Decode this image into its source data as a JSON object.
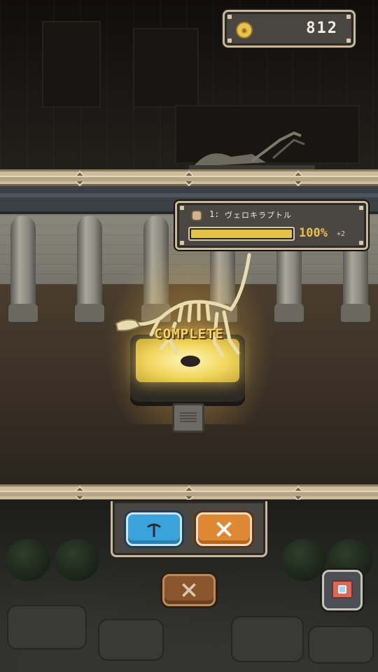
{
  "hud": {
    "coin_amount": "812"
  },
  "fossil_panel": {
    "index_label": "1:",
    "fossil_name": "ヴェロキラプトル",
    "progress_percent": 100,
    "progress_label": "100%",
    "bonus_label": "+2"
  },
  "exhibit": {
    "status_label": "COMPLETE"
  },
  "icons": {
    "coin": "coin-icon",
    "fossil": "fossil-icon",
    "pickaxe": "pickaxe-icon",
    "close": "close-icon",
    "camera": "camera-icon"
  },
  "colors": {
    "panel_bg": "#4a4641",
    "panel_border": "#c9b99a",
    "progress_fill": "#e3c24b",
    "percent_text": "#e8c04c",
    "pickaxe_button": "#3aa3dc",
    "close_button_orange": "#e08733",
    "close_button_brown": "#8a552a",
    "complete_text": "#f3d46b"
  }
}
